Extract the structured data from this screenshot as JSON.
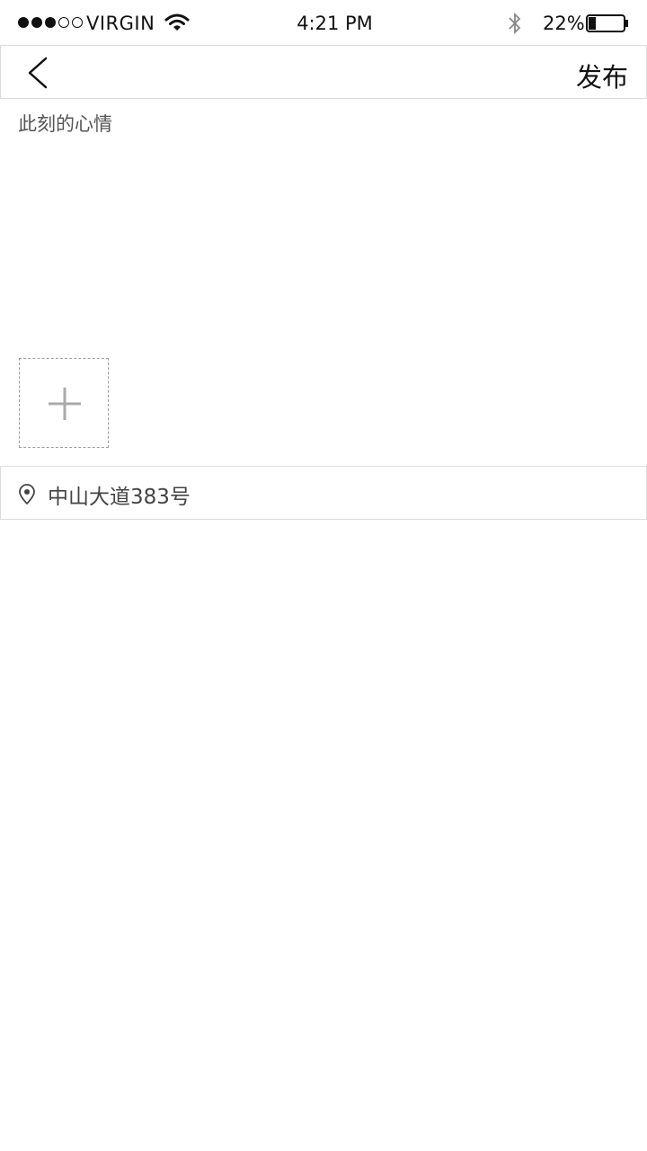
{
  "status_bar": {
    "carrier": "VIRGIN",
    "signal_filled": 3,
    "signal_total": 5,
    "time": "4:21 PM",
    "battery_percent": "22%",
    "battery_level": 0.22,
    "icons": [
      "wifi-icon",
      "bluetooth-icon",
      "battery-icon"
    ]
  },
  "nav": {
    "back_icon": "chevron-left-icon",
    "publish_label": "发布"
  },
  "mood": {
    "placeholder": "此刻的心情"
  },
  "photos": {
    "add_icon": "plus-icon"
  },
  "location": {
    "icon": "location-pin-icon",
    "text": "中山大道383号"
  },
  "colors": {
    "background": "#ffffff",
    "divider": "#dcdcdc",
    "text_primary": "#111111",
    "text_secondary": "#555555",
    "placeholder_border": "#9a9a9a"
  }
}
